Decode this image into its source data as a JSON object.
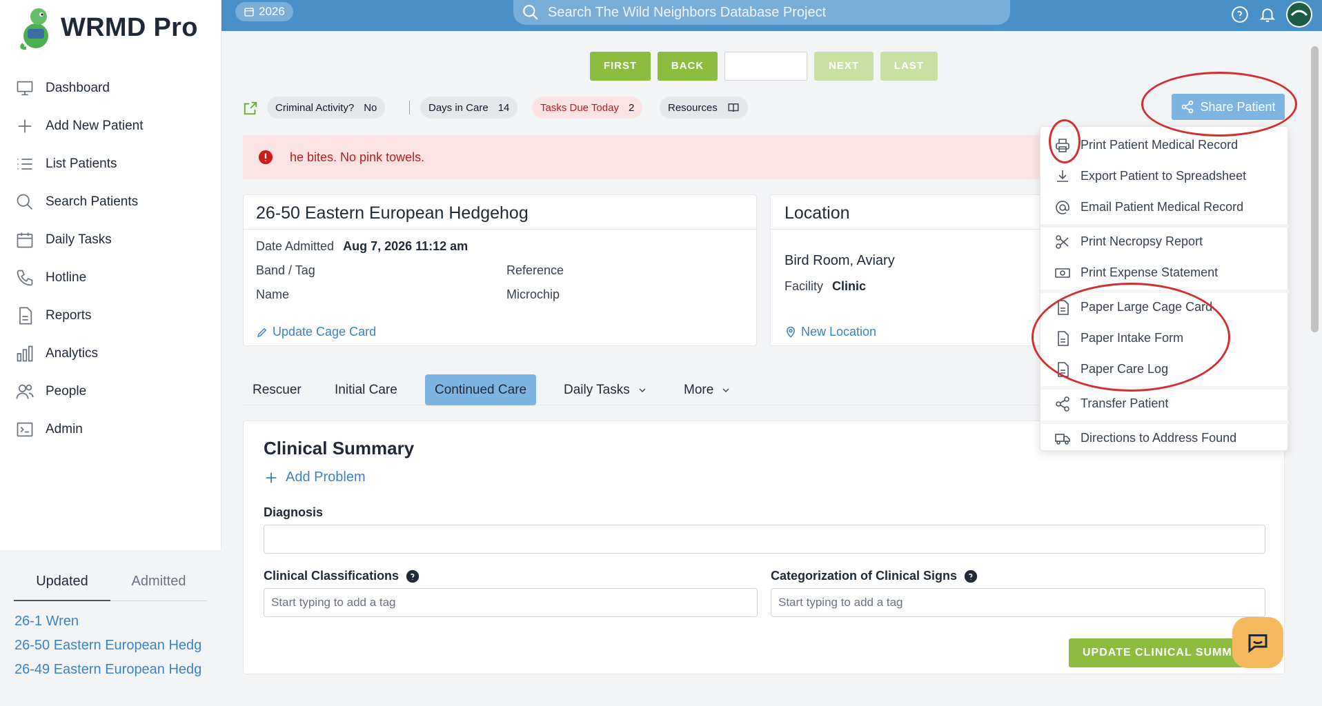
{
  "app": {
    "name": "WRMD Pro"
  },
  "sidebar": {
    "items": [
      {
        "label": "Dashboard",
        "icon": "monitor-icon"
      },
      {
        "label": "Add New Patient",
        "icon": "plus-icon"
      },
      {
        "label": "List Patients",
        "icon": "list-icon"
      },
      {
        "label": "Search Patients",
        "icon": "search-icon"
      },
      {
        "label": "Daily Tasks",
        "icon": "calendar-icon"
      },
      {
        "label": "Hotline",
        "icon": "phone-icon"
      },
      {
        "label": "Reports",
        "icon": "document-icon"
      },
      {
        "label": "Analytics",
        "icon": "bar-chart-icon"
      },
      {
        "label": "People",
        "icon": "users-icon"
      },
      {
        "label": "Admin",
        "icon": "terminal-icon"
      }
    ],
    "recent": {
      "tabs": [
        "Updated",
        "Admitted"
      ],
      "active_tab": "Updated",
      "items": [
        "26-1 Wren",
        "26-50 Eastern European Hedg",
        "26-49 Eastern European Hedg"
      ]
    }
  },
  "topbar": {
    "year": "2026",
    "search_placeholder": "Search The Wild Neighbors Database Project"
  },
  "pager": {
    "first": "FIRST",
    "back": "BACK",
    "next": "NEXT",
    "last": "LAST",
    "input_value": ""
  },
  "badges": {
    "criminal_label": "Criminal Activity?",
    "criminal_value": "No",
    "days_label": "Days in Care",
    "days_value": "14",
    "tasks_label": "Tasks Due Today",
    "tasks_value": "2",
    "resources_label": "Resources"
  },
  "share_button": "Share Patient",
  "alert": {
    "text": "he bites. No pink towels."
  },
  "patient": {
    "title": "26-50 Eastern European Hedgehog",
    "date_admitted_label": "Date Admitted",
    "date_admitted_value": "Aug 7, 2026 11:12 am",
    "band_label": "Band / Tag",
    "reference_label": "Reference",
    "name_label": "Name",
    "microchip_label": "Microchip",
    "update_link": "Update Cage Card"
  },
  "location": {
    "title": "Location",
    "area": "Bird Room, Aviary",
    "facility_label": "Facility",
    "facility_value": "Clinic",
    "new_link": "New Location"
  },
  "tabs": [
    "Rescuer",
    "Initial Care",
    "Continued Care",
    "Daily Tasks",
    "More"
  ],
  "active_tab": "Continued Care",
  "clinical": {
    "title": "Clinical Summary",
    "add_problem": "Add Problem",
    "diagnosis_label": "Diagnosis",
    "diagnosis_value": "",
    "classifications_label": "Clinical Classifications",
    "classifications_placeholder": "Start typing to add a tag",
    "signs_label": "Categorization of Clinical Signs",
    "signs_placeholder": "Start typing to add a tag",
    "update_button": "UPDATE CLINICAL SUMMA"
  },
  "share_menu": [
    {
      "label": "Print Patient Medical Record",
      "icon": "printer-icon"
    },
    {
      "label": "Export Patient to Spreadsheet",
      "icon": "download-icon"
    },
    {
      "label": "Email Patient Medical Record",
      "icon": "at-sign-icon"
    },
    {
      "label": "Print Necropsy Report",
      "icon": "scissors-icon"
    },
    {
      "label": "Print Expense Statement",
      "icon": "money-icon"
    },
    {
      "label": "Paper Large Cage Card",
      "icon": "document-icon"
    },
    {
      "label": "Paper Intake Form",
      "icon": "document-icon"
    },
    {
      "label": "Paper Care Log",
      "icon": "document-icon"
    },
    {
      "label": "Transfer Patient",
      "icon": "share-icon"
    },
    {
      "label": "Directions to Address Found",
      "icon": "truck-icon"
    }
  ],
  "colors": {
    "topbar": "#4a90c8",
    "green": "#8cbd3f",
    "annotation_red": "#d32f2f",
    "accent_blue": "#3b82c4"
  }
}
